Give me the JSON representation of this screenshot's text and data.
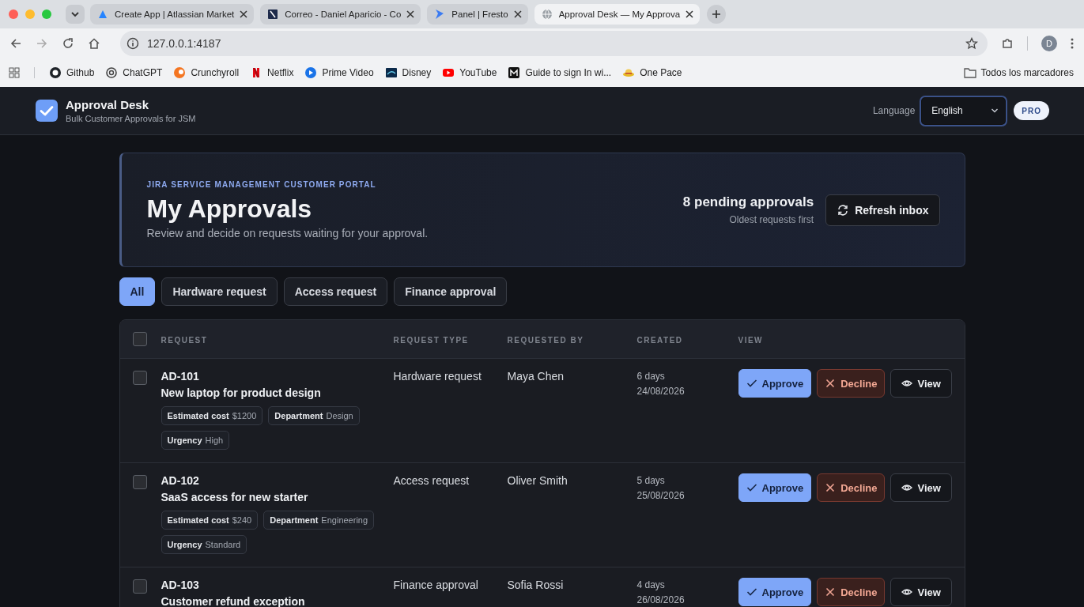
{
  "browser": {
    "tabs": [
      {
        "title": "Create App | Atlassian Market",
        "selected": false
      },
      {
        "title": "Correo - Daniel Aparicio - Co",
        "selected": false
      },
      {
        "title": "Panel | Fresto",
        "selected": false
      },
      {
        "title": "Approval Desk — My Approva",
        "selected": true
      }
    ],
    "address": "127.0.0.1:4187",
    "profile_initial": "D",
    "bookmarks": [
      "Github",
      "ChatGPT",
      "Crunchyroll",
      "Netflix",
      "Prime Video",
      "Disney",
      "YouTube",
      "Guide to sign In wi...",
      "One Pace"
    ],
    "bookmarks_folder": "Todos los marcadores"
  },
  "app": {
    "name": "Approval Desk",
    "tagline": "Bulk Customer Approvals for JSM",
    "language_label": "Language",
    "language": "English",
    "plan_badge": "PRO"
  },
  "hero": {
    "eyebrow": "JIRA SERVICE MANAGEMENT CUSTOMER PORTAL",
    "title": "My Approvals",
    "subtitle": "Review and decide on requests waiting for your approval.",
    "count": "8 pending approvals",
    "count_note": "Oldest requests first",
    "refresh_button": "Refresh inbox"
  },
  "filters": [
    {
      "label": "All",
      "selected": true
    },
    {
      "label": "Hardware request",
      "selected": false
    },
    {
      "label": "Access request",
      "selected": false
    },
    {
      "label": "Finance approval",
      "selected": false
    }
  ],
  "table": {
    "select_all_checked": false,
    "columns": [
      "REQUEST",
      "REQUEST TYPE",
      "REQUESTED BY",
      "CREATED",
      "VIEW"
    ],
    "rows": [
      {
        "checked": false,
        "id": "AD-101",
        "title": "New laptop for product design",
        "attributes": [
          {
            "name": "Estimated cost",
            "value": "$1200"
          },
          {
            "name": "Department",
            "value": "Design"
          },
          {
            "name": "Urgency",
            "value": "High"
          }
        ],
        "type": "Hardware request",
        "requester": "Maya Chen",
        "age": "6 days",
        "date": "24/08/2026",
        "actions": [
          {
            "kind": "approve",
            "label": "Approve"
          },
          {
            "kind": "decline",
            "label": "Decline"
          },
          {
            "kind": "view",
            "label": "View"
          }
        ]
      },
      {
        "checked": false,
        "id": "AD-102",
        "title": "SaaS access for new starter",
        "attributes": [
          {
            "name": "Estimated cost",
            "value": "$240"
          },
          {
            "name": "Department",
            "value": "Engineering"
          },
          {
            "name": "Urgency",
            "value": "Standard"
          }
        ],
        "type": "Access request",
        "requester": "Oliver Smith",
        "age": "5 days",
        "date": "25/08/2026",
        "actions": [
          {
            "kind": "approve",
            "label": "Approve"
          },
          {
            "kind": "decline",
            "label": "Decline"
          },
          {
            "kind": "view",
            "label": "View"
          }
        ]
      },
      {
        "checked": false,
        "id": "AD-103",
        "title": "Customer refund exception",
        "type": "Finance approval",
        "requester": "Sofia Rossi",
        "age": "4 days",
        "date": "26/08/2026",
        "actions": [
          {
            "kind": "approve",
            "label": "Approve"
          },
          {
            "kind": "decline",
            "label": "Decline"
          },
          {
            "kind": "view",
            "label": "View"
          }
        ]
      }
    ]
  }
}
